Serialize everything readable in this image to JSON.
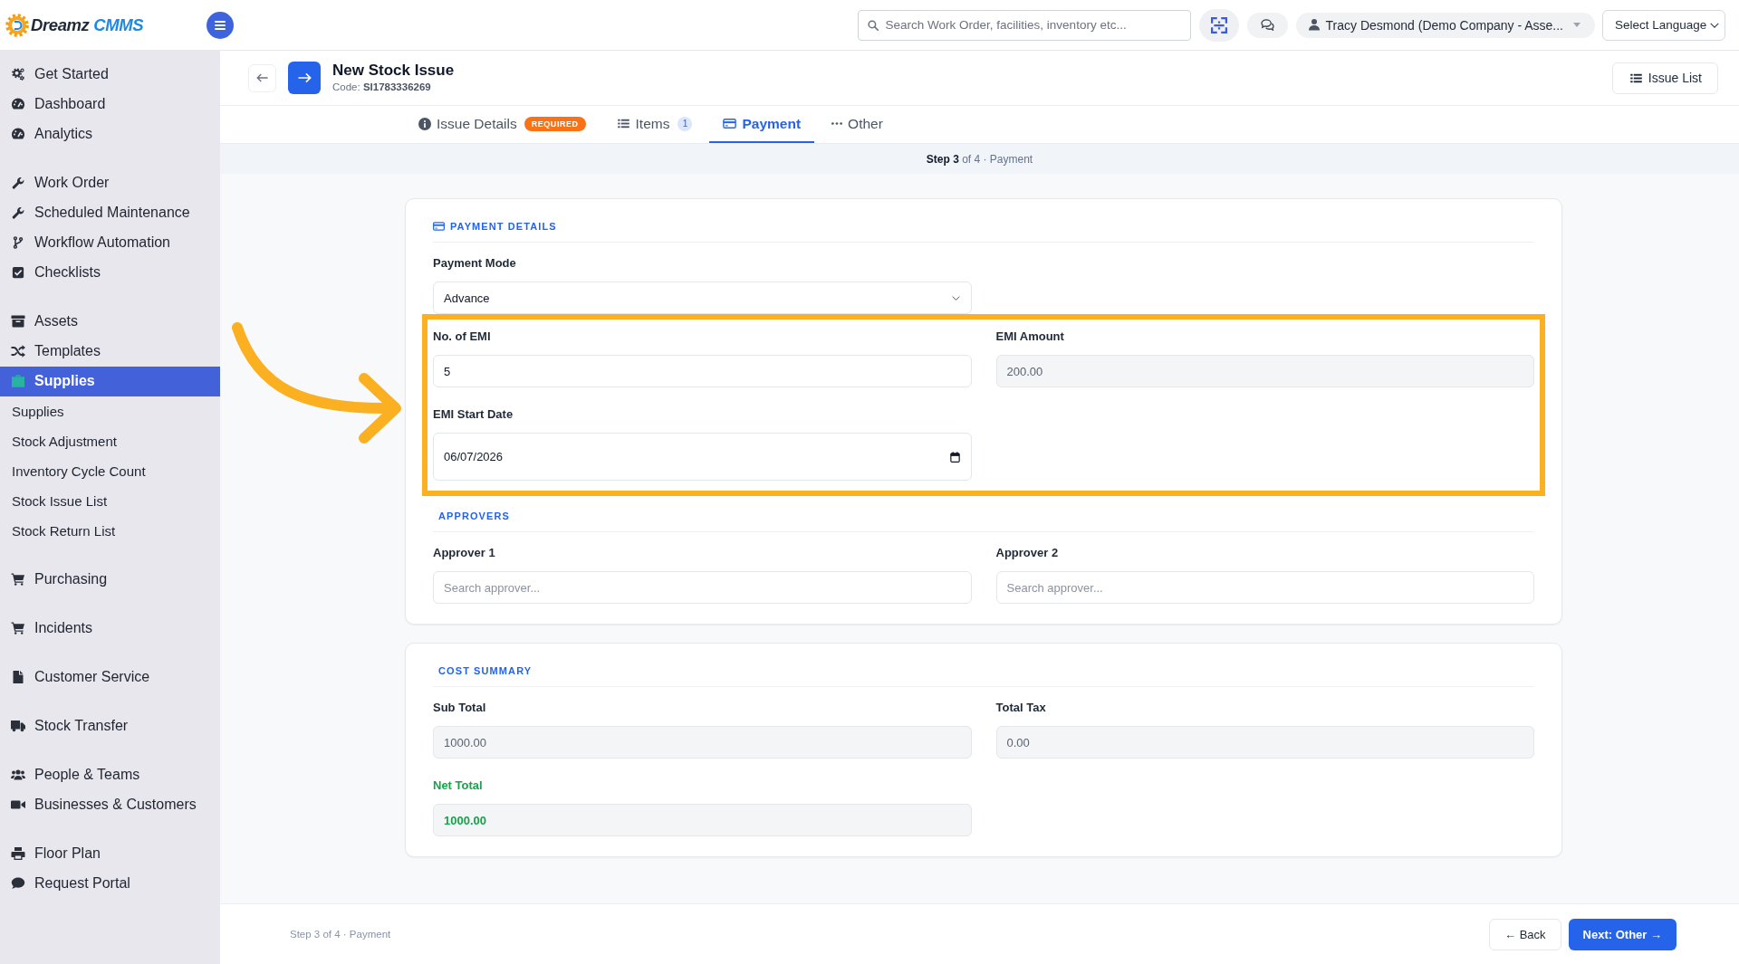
{
  "topbar": {
    "logo": {
      "name": "Dreamz",
      "accent": "CMMS"
    },
    "search": {
      "placeholder": "Search Work Order, facilities, inventory etc..."
    },
    "user": "Tracy Desmond (Demo Company - Asse...",
    "language": "Select Language"
  },
  "sidebar": {
    "groups": [
      {
        "items": [
          {
            "label": "Get Started",
            "selected": false
          },
          {
            "label": "Dashboard",
            "selected": false
          },
          {
            "label": "Analytics",
            "selected": false
          }
        ]
      },
      {
        "items": [
          {
            "label": "Work Order",
            "selected": false
          },
          {
            "label": "Scheduled Maintenance",
            "selected": false
          },
          {
            "label": "Workflow Automation",
            "selected": false
          },
          {
            "label": "Checklists",
            "selected": false
          }
        ]
      },
      {
        "items": [
          {
            "label": "Assets",
            "selected": false
          },
          {
            "label": "Templates",
            "selected": false
          },
          {
            "label": "Supplies",
            "selected": true,
            "children": [
              {
                "label": "Supplies",
                "selected": false
              },
              {
                "label": "Stock Adjustment",
                "selected": false
              },
              {
                "label": "Inventory Cycle Count",
                "selected": false
              },
              {
                "label": "Stock Issue List",
                "selected": false
              },
              {
                "label": "Stock Return List",
                "selected": false
              }
            ]
          }
        ]
      },
      {
        "items": [
          {
            "label": "Purchasing",
            "selected": false
          }
        ]
      },
      {
        "items": [
          {
            "label": "Incidents",
            "selected": false
          }
        ]
      },
      {
        "items": [
          {
            "label": "Customer Service",
            "selected": false
          }
        ]
      },
      {
        "items": [
          {
            "label": "Stock Transfer",
            "selected": false
          }
        ]
      },
      {
        "items": [
          {
            "label": "People & Teams",
            "selected": false
          },
          {
            "label": "Businesses & Customers",
            "selected": false
          }
        ]
      },
      {
        "items": [
          {
            "label": "Floor Plan",
            "selected": false
          },
          {
            "label": "Request Portal",
            "selected": false
          }
        ]
      }
    ]
  },
  "header": {
    "title": "New Stock Issue",
    "code": "Code: **SI1783336269**",
    "list_button": "Issue List"
  },
  "tabs": [
    {
      "label": "Issue Details",
      "selected": false,
      "badge": {
        "kind": "required",
        "text": "REQUIRED"
      }
    },
    {
      "label": "Items",
      "selected": false,
      "badge": {
        "kind": "count",
        "text": "1"
      }
    },
    {
      "label": "Payment",
      "selected": true
    },
    {
      "label": "Other",
      "selected": false
    }
  ],
  "step_bar": "**Step 3** of 4 · Payment",
  "cards": [
    {
      "sections": [
        {
          "title": "PAYMENT DETAILS",
          "fields": [
            {
              "kind": "select",
              "label": "Payment Mode",
              "value": "Advance"
            }
          ],
          "highlight": [
            {
              "kind": "text",
              "label": "No. of EMI",
              "value": "5"
            },
            {
              "kind": "readonly",
              "label": "EMI Amount",
              "value": "200.00"
            },
            {
              "kind": "date",
              "label": "EMI Start Date",
              "value": "06/07/2026"
            }
          ]
        },
        {
          "title": "APPROVERS",
          "fields": [
            {
              "kind": "text",
              "label": "Approver 1",
              "placeholder": "Search approver..."
            },
            {
              "kind": "text",
              "label": "Approver 2",
              "placeholder": "Search approver..."
            }
          ]
        }
      ]
    },
    {
      "sections": [
        {
          "title": "COST SUMMARY",
          "fields": [
            {
              "kind": "readonly",
              "label": "Sub Total",
              "value": "1000.00"
            },
            {
              "kind": "readonly",
              "label": "Total Tax",
              "value": "0.00"
            },
            {
              "kind": "total",
              "label": "Net Total",
              "value": "1000.00"
            }
          ]
        }
      ]
    }
  ],
  "footer": {
    "step": "Step 3 of 4 · Payment",
    "buttons": [
      {
        "kind": "secondary",
        "label": "← Back"
      },
      {
        "kind": "primary",
        "label": "Next: Other →"
      }
    ]
  }
}
